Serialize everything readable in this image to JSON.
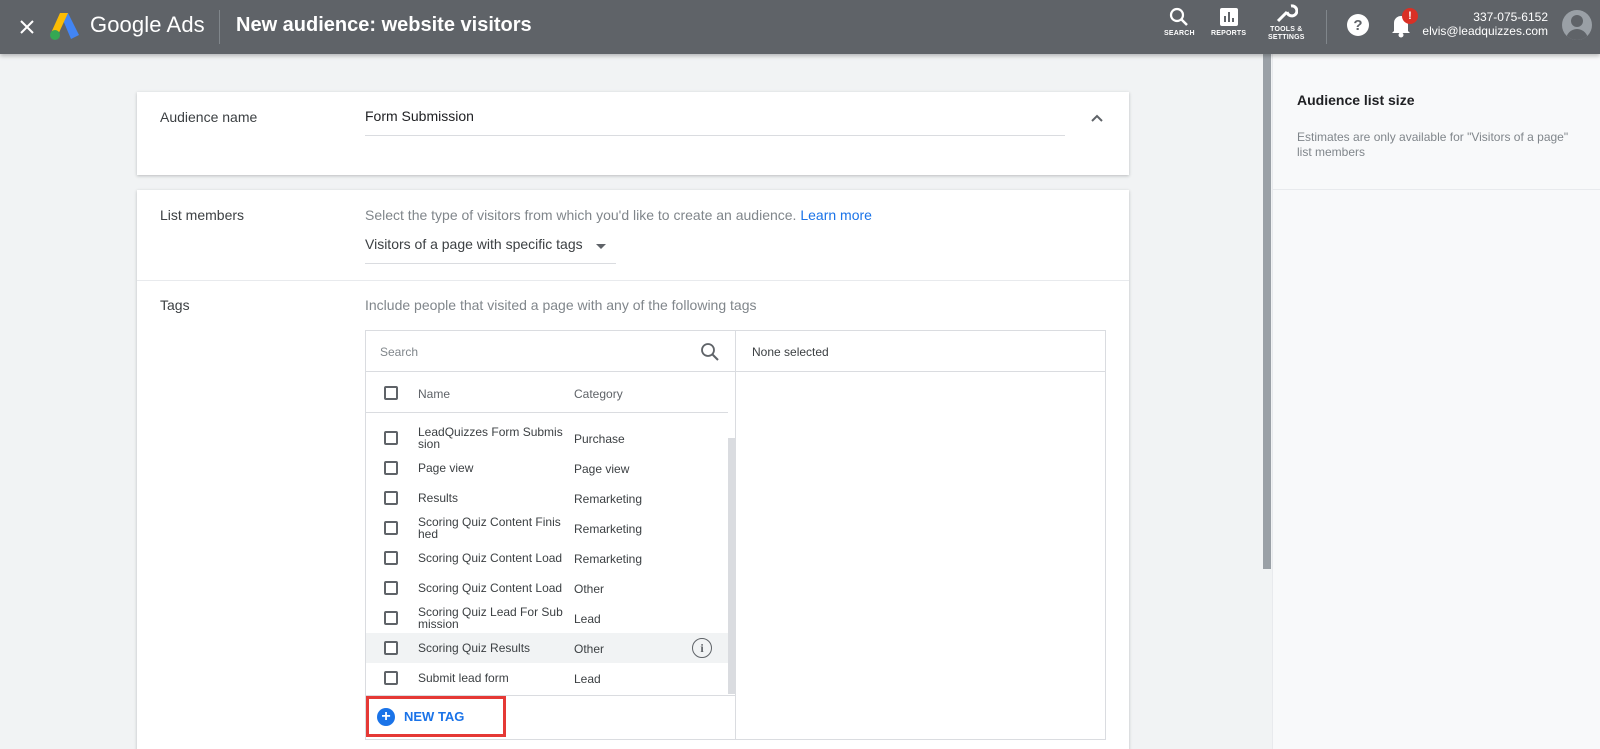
{
  "topbar": {
    "brand": "Google Ads",
    "title": "New audience: website visitors",
    "actions": [
      {
        "label": "SEARCH",
        "icon": "search-icon"
      },
      {
        "label": "REPORTS",
        "icon": "reports-icon"
      },
      {
        "label": "TOOLS &\nSETTINGS",
        "icon": "wrench-icon"
      }
    ],
    "notification_badge": "!",
    "account": {
      "phone": "337-075-6152",
      "email": "elvis@leadquizzes.com"
    }
  },
  "audience_name": {
    "label": "Audience name",
    "value": "Form Submission"
  },
  "list_members": {
    "label": "List members",
    "hint": "Select the type of visitors from which you'd like to create an audience.",
    "learn_more": "Learn more",
    "selected": "Visitors of a page with specific tags"
  },
  "tags": {
    "label": "Tags",
    "hint": "Include people that visited a page with any of the following tags",
    "search_placeholder": "Search",
    "columns": {
      "name": "Name",
      "category": "Category"
    },
    "rows": [
      {
        "name": "LeadQuizzes Form Submission",
        "category": "Purchase"
      },
      {
        "name": "Page view",
        "category": "Page view"
      },
      {
        "name": "Results",
        "category": "Remarketing"
      },
      {
        "name": "Scoring Quiz Content Finished",
        "category": "Remarketing"
      },
      {
        "name": "Scoring Quiz Content Load",
        "category": "Remarketing"
      },
      {
        "name": "Scoring Quiz Content Load",
        "category": "Other"
      },
      {
        "name": "Scoring Quiz Lead For Submission",
        "category": "Lead"
      },
      {
        "name": "Scoring Quiz Results",
        "category": "Other",
        "highlighted": true
      },
      {
        "name": "Submit lead form",
        "category": "Lead"
      }
    ],
    "new_tag": "NEW TAG",
    "selected_header": "None selected",
    "annotation_color": "#e53935"
  },
  "side_panel": {
    "title": "Audience list size",
    "note": "Estimates are only available for \"Visitors of a page\" list members"
  },
  "colors": {
    "topbar": "#5f6368",
    "link": "#1a73e8",
    "badge": "#d93025"
  }
}
